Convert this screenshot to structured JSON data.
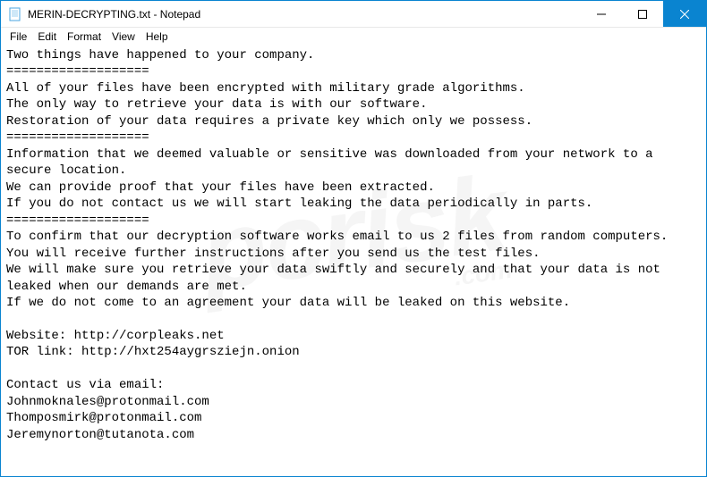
{
  "titlebar": {
    "icon_name": "notepad-icon",
    "title": "MERIN-DECRYPTING.txt - Notepad",
    "buttons": {
      "min": "🗕",
      "max": "🗖",
      "close": "🗙"
    }
  },
  "menubar": {
    "items": [
      "File",
      "Edit",
      "Format",
      "View",
      "Help"
    ]
  },
  "document": {
    "body": "Two things have happened to your company.\n===================\nAll of your files have been encrypted with military grade algorithms.\nThe only way to retrieve your data is with our software.\nRestoration of your data requires a private key which only we possess.\n===================\nInformation that we deemed valuable or sensitive was downloaded from your network to a secure location.\nWe can provide proof that your files have been extracted.\nIf you do not contact us we will start leaking the data periodically in parts.\n===================\nTo confirm that our decryption software works email to us 2 files from random computers.\nYou will receive further instructions after you send us the test files.\nWe will make sure you retrieve your data swiftly and securely and that your data is not leaked when our demands are met.\nIf we do not come to an agreement your data will be leaked on this website.\n\nWebsite: http://corpleaks.net\nTOR link: http://hxt254aygrsziejn.onion\n\nContact us via email:\nJohnmoknales@protonmail.com\nThomposmirk@protonmail.com\nJeremynorton@tutanota.com"
  },
  "watermark": {
    "main": "pcrisk",
    "sub": ".com"
  }
}
